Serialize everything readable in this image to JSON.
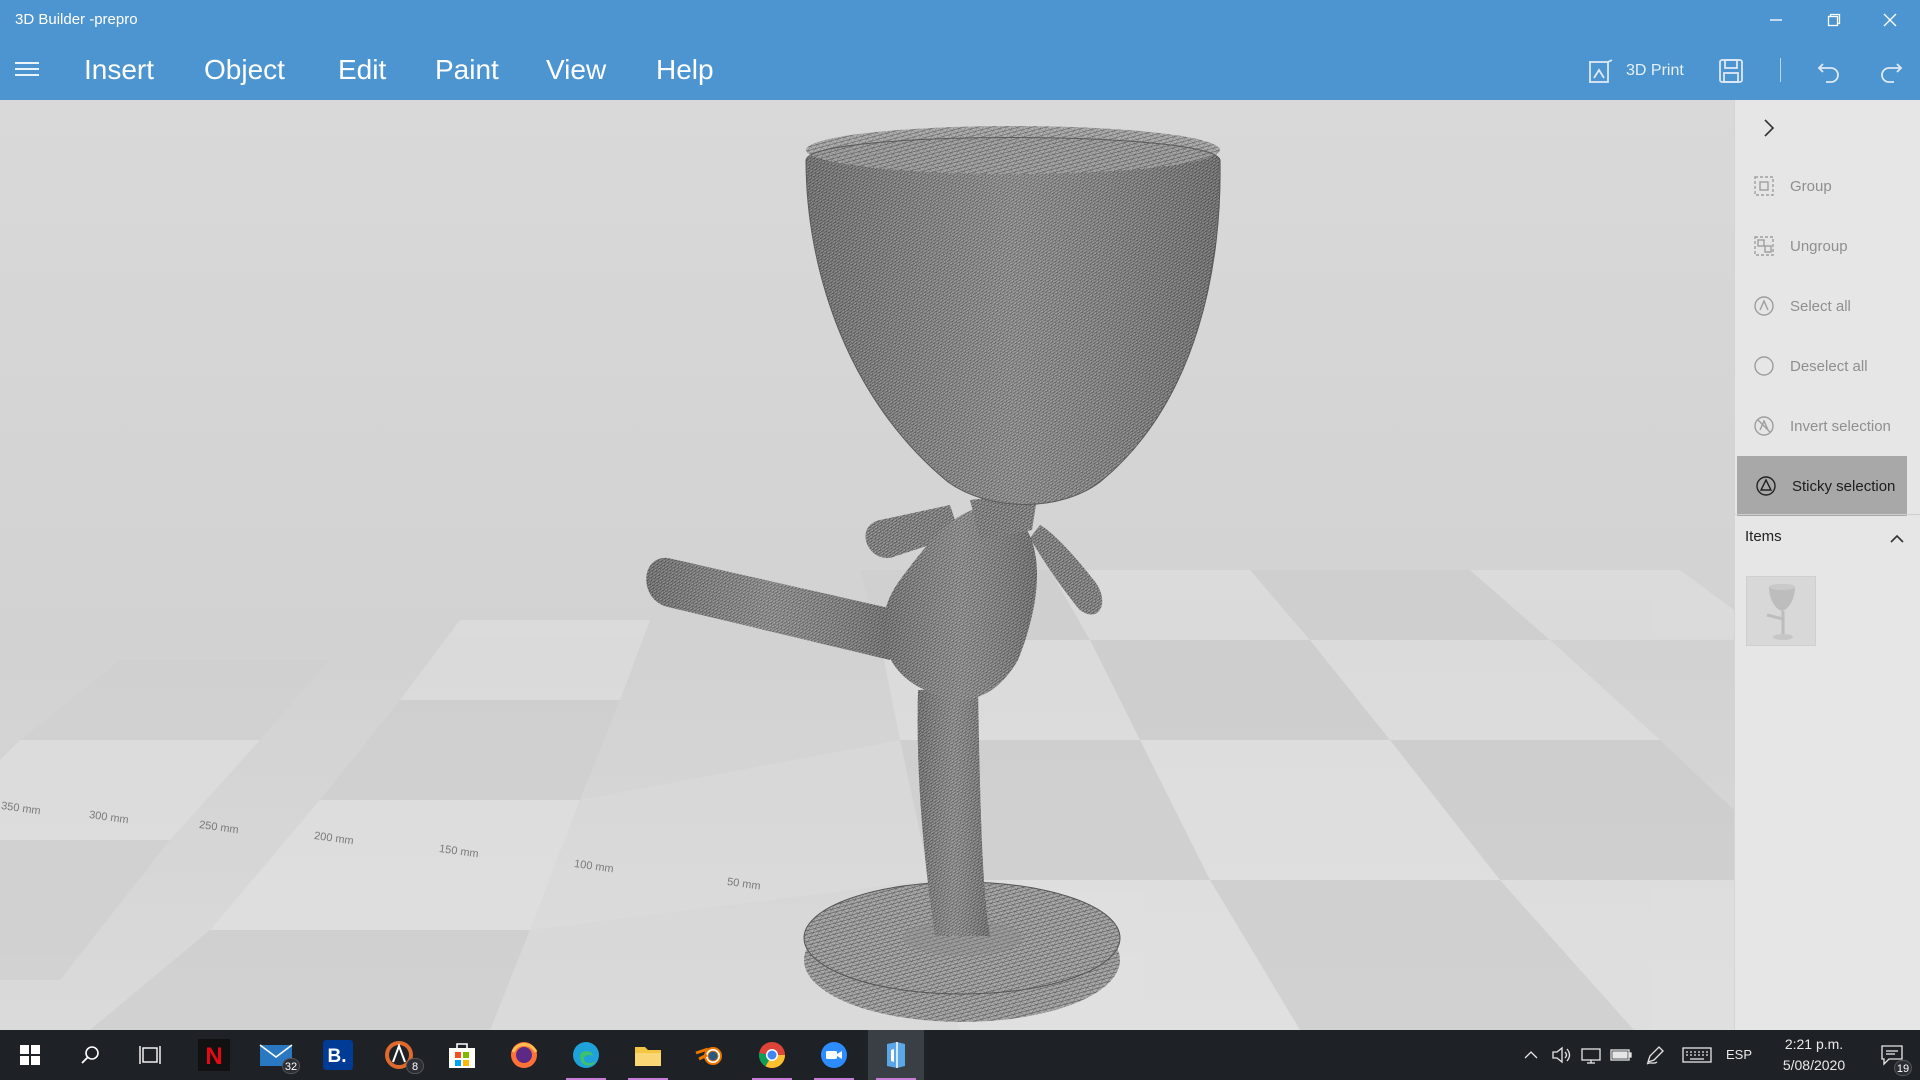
{
  "window": {
    "title": "3D Builder -prepro",
    "controls": [
      "minimize-icon",
      "restore-icon",
      "close-icon"
    ]
  },
  "menu": {
    "items": [
      "Insert",
      "Object",
      "Edit",
      "Paint",
      "View",
      "Help"
    ]
  },
  "toolbar": {
    "print_label": "3D Print",
    "icons": [
      "3d-print-icon",
      "save-icon",
      "undo-icon",
      "redo-icon"
    ]
  },
  "viewport": {
    "ruler_labels": [
      "50 mm",
      "100 mm",
      "150 mm",
      "200 mm",
      "250 mm",
      "300 mm",
      "350 mm"
    ]
  },
  "panel": {
    "actions": [
      {
        "label": "Group",
        "icon": "group-icon",
        "active": false
      },
      {
        "label": "Ungroup",
        "icon": "ungroup-icon",
        "active": false
      },
      {
        "label": "Select all",
        "icon": "select-all-icon",
        "active": false
      },
      {
        "label": "Deselect all",
        "icon": "deselect-all-icon",
        "active": false
      },
      {
        "label": "Invert selection",
        "icon": "invert-selection-icon",
        "active": false
      },
      {
        "label": "Sticky selection",
        "icon": "sticky-selection-icon",
        "active": true
      }
    ],
    "items_header": "Items"
  },
  "taskbar": {
    "apps": [
      "Netflix",
      "Mail",
      "Booking",
      "Avast",
      "Microsoft Store",
      "Firefox",
      "Edge",
      "File Explorer",
      "Blender",
      "Chrome",
      "Zoom",
      "3D Builder"
    ],
    "mail_badge": "32",
    "avast_badge": "8",
    "language": "ESP",
    "time": "2:21 p.m.",
    "date": "5/08/2020",
    "notification_count": "19"
  },
  "colors": {
    "accent": "#4d95d0",
    "panel_bg": "#e6e6e6",
    "active_item": "#a8a8a8",
    "taskbar": "#1e2126"
  }
}
